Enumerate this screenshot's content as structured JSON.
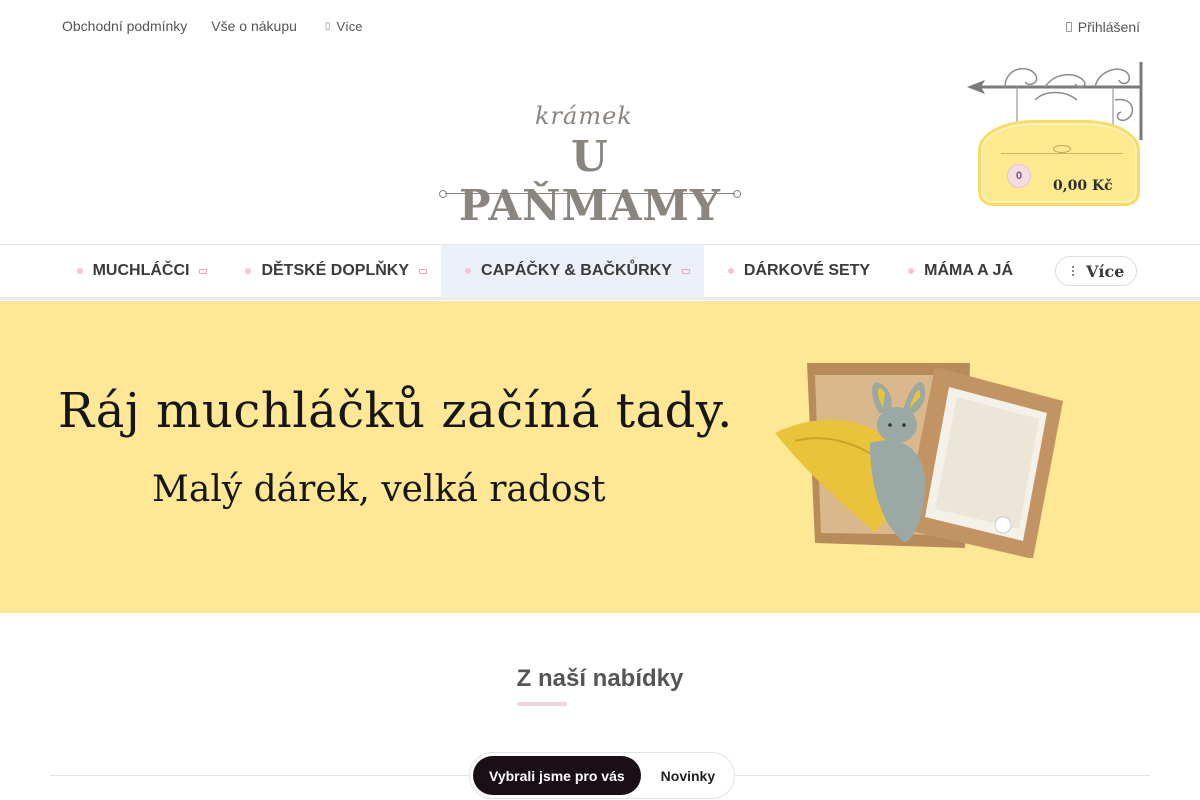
{
  "top_links": [
    {
      "label": "Obchodní podmínky"
    },
    {
      "label": "Vše o nákupu"
    },
    {
      "label": "Více",
      "icon": "more-icon"
    }
  ],
  "login": {
    "label": "Přihlášení",
    "icon": "user-icon"
  },
  "logo": {
    "small": "krámek",
    "main": "U PAŇMAMY"
  },
  "cart": {
    "count": "0",
    "total": "0,00 Kč"
  },
  "nav": {
    "items": [
      {
        "label": "MUCHLÁČCI",
        "has_submenu": true
      },
      {
        "label": "DĚTSKÉ DOPLŇKY",
        "has_submenu": true
      },
      {
        "label": "CAPÁČKY & BAČKŮRKY",
        "has_submenu": true,
        "active": true
      },
      {
        "label": "DÁRKOVÉ SETY",
        "has_submenu": false
      },
      {
        "label": "MÁMA A JÁ",
        "has_submenu": false
      }
    ],
    "more_label": "Více"
  },
  "hero": {
    "headline": "Ráj muchláčků začíná tady.",
    "subline": "Malý dárek, velká radost"
  },
  "section": {
    "title": "Z naší nabídky"
  },
  "tabs": [
    {
      "label": "Vybrali jsme pro vás",
      "selected": true
    },
    {
      "label": "Novinky",
      "selected": false
    }
  ],
  "colors": {
    "hero_background": "#fee895",
    "accent_pink": "#f2d2dc",
    "nav_active_bg": "#ecf0f8",
    "tab_selected_bg": "#1a0f17"
  }
}
